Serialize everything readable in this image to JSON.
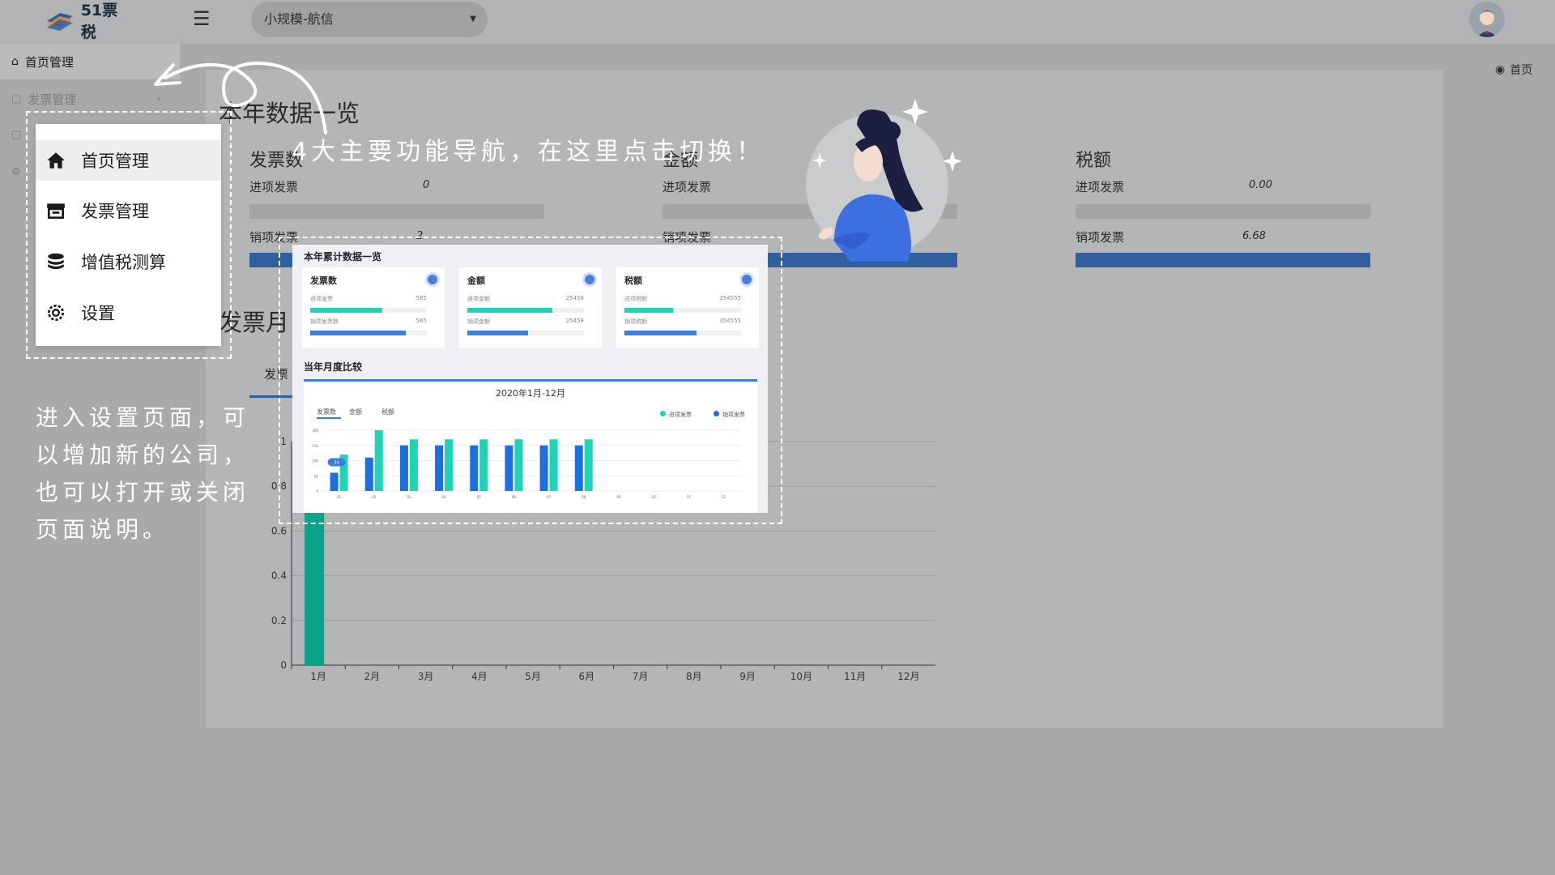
{
  "app": {
    "logo_text": "51票税",
    "company": "小规模-航信"
  },
  "sidebar": {
    "items": [
      {
        "label": "首页管理",
        "icon": "home-icon"
      },
      {
        "label": "发票管理",
        "icon": "folder-icon"
      },
      {
        "label": "增值税测算",
        "icon": "coins-icon"
      },
      {
        "label": "设置",
        "icon": "gear-icon"
      }
    ]
  },
  "breadcrumb": {
    "label": "首页"
  },
  "summary": {
    "title": "本年数据一览",
    "cards": [
      {
        "title": "发票数",
        "rows": [
          {
            "label": "进项发票",
            "value": "0",
            "fill": 0
          },
          {
            "label": "销项发票",
            "value": "2",
            "fill": 1
          }
        ]
      },
      {
        "title": "金额",
        "rows": [
          {
            "label": "进项发票",
            "value": "0",
            "fill": 0
          },
          {
            "label": "销项发票",
            "value": "",
            "fill": 1
          }
        ]
      },
      {
        "title": "税额",
        "rows": [
          {
            "label": "进项发票",
            "value": "0.00",
            "fill": 0
          },
          {
            "label": "销项发票",
            "value": "6.68",
            "fill": 1
          }
        ]
      }
    ]
  },
  "monthly": {
    "title": "发票月",
    "tab": "发票"
  },
  "chart_data": {
    "type": "bar",
    "categories": [
      "1月",
      "2月",
      "3月",
      "4月",
      "5月",
      "6月",
      "7月",
      "8月",
      "9月",
      "10月",
      "11月",
      "12月"
    ],
    "values": [
      1,
      0,
      0,
      0,
      0,
      0,
      0,
      0,
      0,
      0,
      0,
      0
    ],
    "ylim": [
      0,
      1
    ],
    "yticks": [
      0,
      0.2,
      0.4,
      0.6,
      0.8,
      1
    ],
    "ytick_labels": [
      "0",
      "0.2",
      "0.4",
      "0.6",
      "0.8",
      "1"
    ],
    "bar_color": "#0aa389",
    "grid": true
  },
  "overlay": {
    "menu_items": [
      {
        "label": "首页管理",
        "icon": "home-icon",
        "active": true
      },
      {
        "label": "发票管理",
        "icon": "invoice-icon"
      },
      {
        "label": "增值税测算",
        "icon": "coins-icon"
      },
      {
        "label": "设置",
        "icon": "gear-icon"
      }
    ],
    "nav_tip": "4大主要功能导航，在这里点击切换！",
    "settings_tip": "进入设置页面，可以增加新的公司，也可以打开或关闭页面说明。"
  },
  "preview": {
    "title": "本年累计数据一览",
    "cards": [
      {
        "title": "发票数",
        "row1_label": "进项发票",
        "row1_value": "565",
        "row1_fill": 0.62,
        "row2_label": "销项发票数",
        "row2_value": "565",
        "row2_fill": 0.82
      },
      {
        "title": "金额",
        "row1_label": "进项金额",
        "row1_value": "25458",
        "row1_fill": 0.73,
        "row2_label": "销项金额",
        "row2_value": "25458",
        "row2_fill": 0.52
      },
      {
        "title": "税额",
        "row1_label": "进项税额",
        "row1_value": "354555",
        "row1_fill": 0.42,
        "row2_label": "销项税额",
        "row2_value": "354555",
        "row2_fill": 0.62
      }
    ],
    "chart_title": "当年月度比较",
    "chart_subtitle": "2020年1月-12月",
    "tabs": [
      "发票数",
      "金额",
      "税额"
    ],
    "legend": [
      {
        "name": "进项发票",
        "color": "#1fd3b6"
      },
      {
        "name": "销项发票",
        "color": "#1c6fe0"
      }
    ],
    "badge": "34",
    "bars_blue": [
      0.3,
      0.55,
      0.75,
      0.75,
      0.75,
      0.75,
      0.75,
      0.75
    ],
    "bars_teal": [
      0.6,
      1.0,
      0.85,
      0.85,
      0.85,
      0.85,
      0.85,
      0.85
    ],
    "bar_count": 12,
    "x_labels": [
      "01",
      "02",
      "03",
      "04",
      "05",
      "06",
      "07",
      "08",
      "09",
      "10",
      "11",
      "12"
    ],
    "y_labels": [
      "0",
      "50",
      "100",
      "150",
      "200"
    ]
  },
  "colors": {
    "accent": "#2f5f9c",
    "teal": "#0aa389"
  }
}
